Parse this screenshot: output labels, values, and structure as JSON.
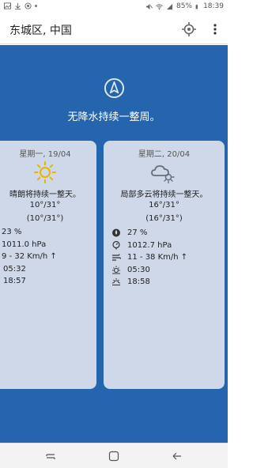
{
  "status_bar": {
    "battery": "85%",
    "time": "18:39",
    "icons": [
      "image-icon",
      "download-icon",
      "target-icon",
      "dot-icon",
      "mute-icon",
      "wifi-icon",
      "signal-icon",
      "battery-icon"
    ]
  },
  "app_bar": {
    "title": "东城区, 中国",
    "icons": [
      "location-crosshair-icon",
      "more-vert-icon"
    ]
  },
  "summary": {
    "icon": "compass-icon",
    "text": "无降水持续一整周。"
  },
  "cards": [
    {
      "date": "星期一, 19/04",
      "icon": "sun-icon",
      "desc": "晴朗将持续一整天。",
      "temp": "10°/31°",
      "feels": "(10°/31°)",
      "humidity": "23 %",
      "pressure": "1011.0 hPa",
      "wind": "9 - 32 Km/h ↑",
      "sunrise": "05:32",
      "sunset": "18:57"
    },
    {
      "date": "星期二, 20/04",
      "icon": "partly-cloudy-day-icon",
      "desc": "局部多云将持续一整天。",
      "temp": "16°/31°",
      "feels": "(16°/31°)",
      "humidity": "27 %",
      "pressure": "1012.7 hPa",
      "wind": "11 - 38 Km/h ↑",
      "sunrise": "05:30",
      "sunset": "18:58"
    }
  ],
  "nav_bar": {
    "icons": [
      "recent-apps-icon",
      "home-icon",
      "back-icon"
    ]
  },
  "colors": {
    "background_blue": "#2465ad",
    "card": "#ced8e8",
    "sun": "#e8b400"
  }
}
